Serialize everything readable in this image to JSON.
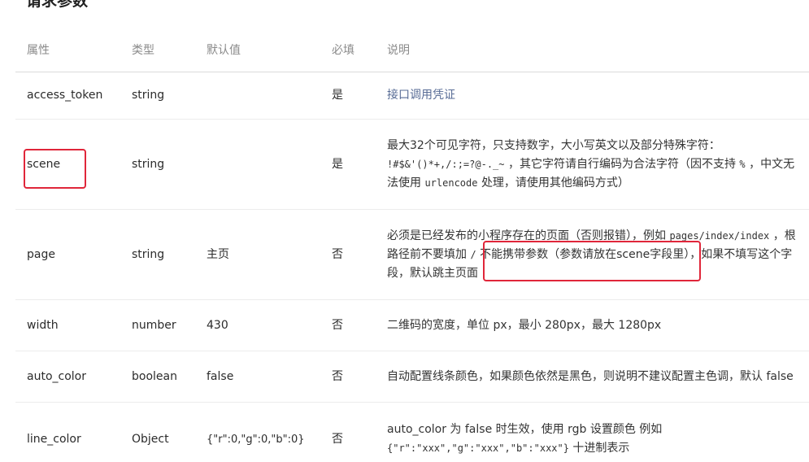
{
  "section_title": "请求参数",
  "headers": {
    "name": "属性",
    "type": "类型",
    "default": "默认值",
    "required": "必填",
    "description": "说明"
  },
  "rows": [
    {
      "name": "access_token",
      "type": "string",
      "default": "",
      "required": "是",
      "description": [
        "接口调用凭证"
      ]
    },
    {
      "name": "scene",
      "type": "string",
      "default": "",
      "required": "是",
      "description": [
        "最大32个可见字符，只支持数字，大小写英文以及部分特殊字符：",
        "!#$&'()*+,/:;=?@-._~",
        "，其它字符请自行编码为合法字符（因不支持",
        "%",
        "，中文无",
        "法使用",
        "urlencode",
        "处理，请使用其他编码方式）"
      ]
    },
    {
      "name": "page",
      "type": "string",
      "default": "主页",
      "required": "否",
      "description": [
        "必须是已经发布的小程序存在的页面（否则报错），例如",
        "pages/index/index",
        "，根",
        "路径前不要填加",
        "/",
        "不能携带参数（参数请放在scene字段里），如果不填写这个字",
        "段，默认跳主页面"
      ]
    },
    {
      "name": "width",
      "type": "number",
      "default": "430",
      "required": "否",
      "description": [
        "二维码的宽度，单位 px，最小 280px，最大 1280px"
      ]
    },
    {
      "name": "auto_color",
      "type": "boolean",
      "default": "false",
      "required": "否",
      "description": [
        "自动配置线条颜色，如果颜色依然是黑色，则说明不建议配置主色调，默认 false"
      ]
    },
    {
      "name": "line_color",
      "type": "Object",
      "default": "{\"r\":0,\"g\":0,\"b\":0}",
      "required": "否",
      "description": [
        "auto_color 为 false 时生效，使用 rgb 设置颜色 例如",
        "{\"r\":\"xxx\",\"g\":\"xxx\",\"b\":\"xxx\"}",
        "十进制表示"
      ]
    }
  ],
  "colors": {
    "highlight_box": "#e0263a",
    "link": "#576b95"
  }
}
